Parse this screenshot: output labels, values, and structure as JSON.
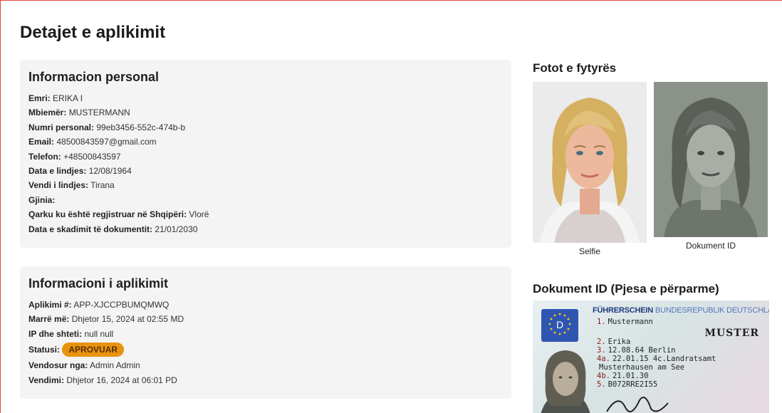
{
  "page": {
    "title": "Detajet e aplikimit"
  },
  "personal": {
    "title": "Informacion personal",
    "fields": [
      {
        "label": "Emri:",
        "value": "ERIKA I"
      },
      {
        "label": "Mbiemër:",
        "value": "MUSTERMANN"
      },
      {
        "label": "Numri personal:",
        "value": "99eb3456-552c-474b-b"
      },
      {
        "label": "Email:",
        "value": "48500843597@gmail.com"
      },
      {
        "label": "Telefon:",
        "value": "+48500843597"
      },
      {
        "label": "Data e lindjes:",
        "value": "12/08/1964"
      },
      {
        "label": "Vendi i lindjes:",
        "value": "Tirana"
      },
      {
        "label": "Gjinia:",
        "value": ""
      },
      {
        "label": "Qarku ku është regjistruar në Shqipëri:",
        "value": "Vlorë"
      },
      {
        "label": "Data e skadimit të dokumentit:",
        "value": "21/01/2030"
      }
    ]
  },
  "application": {
    "title": "Informacioni i aplikimit",
    "fields": [
      {
        "label": "Aplikimi #:",
        "value": "APP-XJCCPBUMQMWQ"
      },
      {
        "label": "Marrë më:",
        "value": "Dhjetor 15, 2024 at 02:55 MD"
      },
      {
        "label": "IP dhe shteti:",
        "value": "null null"
      },
      {
        "label": "Statusi:",
        "value": "APROVUAR"
      },
      {
        "label": "Vendosur nga:",
        "value": "Admin Admin"
      },
      {
        "label": "Vendimi:",
        "value": "Dhjetor 16, 2024 at 06:01 PD"
      }
    ],
    "status_color": "#e8930f"
  },
  "faces": {
    "title": "Fotot e fytyrës",
    "selfie_caption": "Selfie",
    "document_caption": "Dokument ID"
  },
  "id_front": {
    "title": "Dokument ID (Pjesa e përparme)",
    "license": {
      "country_letter": "D",
      "heading": "FÜHRERSCHEIN",
      "heading_sub": "BUNDESREPUBLIK DEUTSCHLAND",
      "muster": "MUSTER",
      "lines": [
        {
          "num": "1.",
          "text": "Mustermann"
        },
        {
          "num": "2.",
          "text": "Erika"
        },
        {
          "num": "3.",
          "text": "12.08.64  Berlin"
        },
        {
          "num": "4a.",
          "text": "22.01.15  4c.Landratsamt"
        },
        {
          "num": "",
          "text": "Musterhausen am See"
        },
        {
          "num": "4b.",
          "text": "21.01.30"
        },
        {
          "num": "5.",
          "text": "B072RRE2I55"
        }
      ]
    }
  }
}
